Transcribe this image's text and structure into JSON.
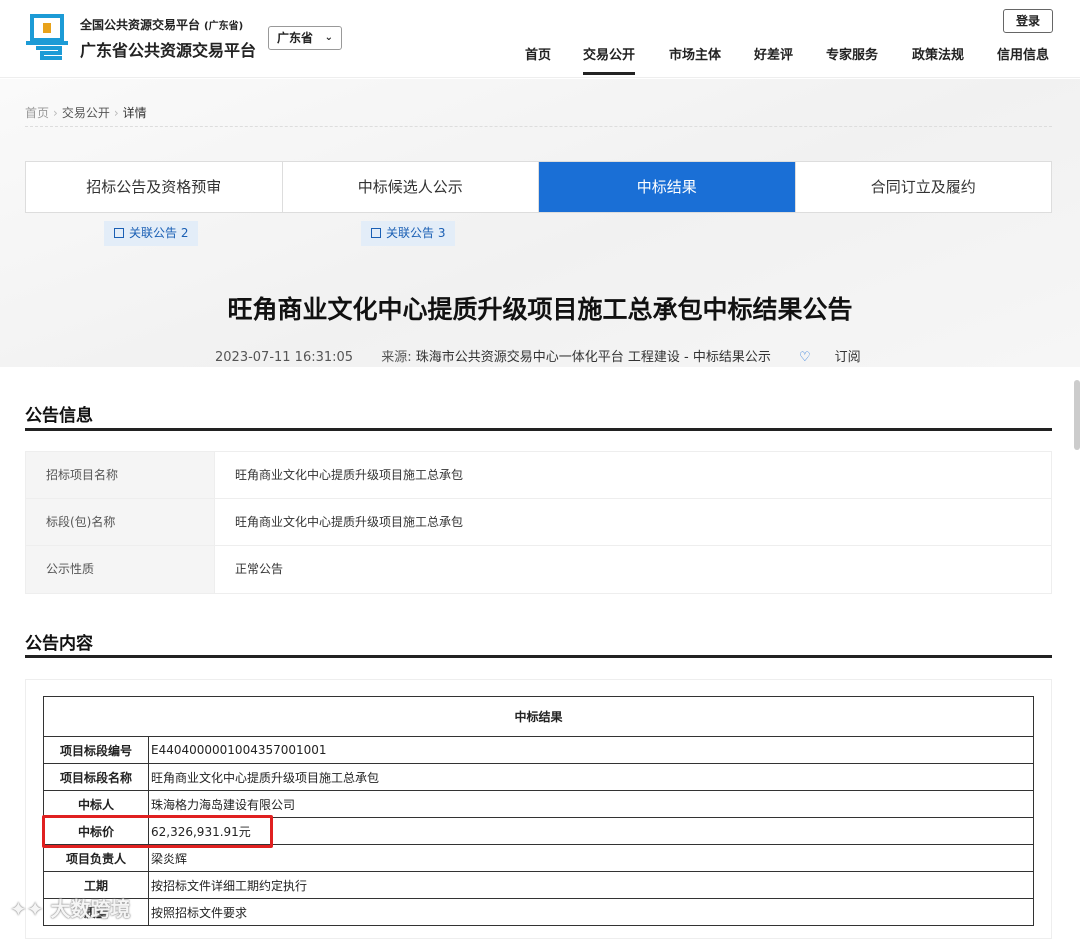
{
  "header": {
    "platform_line1": "全国公共资源交易平台",
    "platform_line1_note": "(广东省)",
    "platform_line2": "广东省公共资源交易平台",
    "province": "广东省",
    "login": "登录",
    "nav": [
      {
        "label": "首页"
      },
      {
        "label": "交易公开",
        "active": true
      },
      {
        "label": "市场主体"
      },
      {
        "label": "好差评"
      },
      {
        "label": "专家服务"
      },
      {
        "label": "政策法规"
      },
      {
        "label": "信用信息"
      }
    ],
    "accent_color": "#1a6fd6"
  },
  "breadcrumb": [
    "首页",
    "交易公开",
    "详情"
  ],
  "tabs": [
    {
      "label": "招标公告及资格预审"
    },
    {
      "label": "中标候选人公示"
    },
    {
      "label": "中标结果",
      "active": true
    },
    {
      "label": "合同订立及履约"
    }
  ],
  "related": [
    {
      "label": "关联公告 2"
    },
    {
      "label": "关联公告 3"
    }
  ],
  "doc": {
    "title": "旺角商业文化中心提质升级项目施工总承包中标结果公告",
    "datetime": "2023-07-11 16:31:05",
    "source_label": "来源:",
    "source": "珠海市公共资源交易中心一体化平台 工程建设 - 中标结果公示",
    "subscribe": "订阅"
  },
  "info_section": {
    "title": "公告信息",
    "rows": [
      {
        "label": "招标项目名称",
        "value": "旺角商业文化中心提质升级项目施工总承包"
      },
      {
        "label": "标段(包)名称",
        "value": "旺角商业文化中心提质升级项目施工总承包"
      },
      {
        "label": "公示性质",
        "value": "正常公告"
      }
    ]
  },
  "content_section": {
    "title": "公告内容",
    "table_title": "中标结果",
    "rows": [
      {
        "label": "项目标段编号",
        "value": "E4404000001004357001001"
      },
      {
        "label": "项目标段名称",
        "value": "旺角商业文化中心提质升级项目施工总承包"
      },
      {
        "label": "中标人",
        "value": "珠海格力海岛建设有限公司"
      },
      {
        "label": "中标价",
        "value": "62,326,931.91元"
      },
      {
        "label": "项目负责人",
        "value": "梁炎辉"
      },
      {
        "label": "工期",
        "value": "按招标文件详细工期约定执行"
      },
      {
        "label": "质量",
        "value": "按照招标文件要求"
      }
    ]
  },
  "watermark": "大数跨境",
  "highlight_color": "#e02020"
}
